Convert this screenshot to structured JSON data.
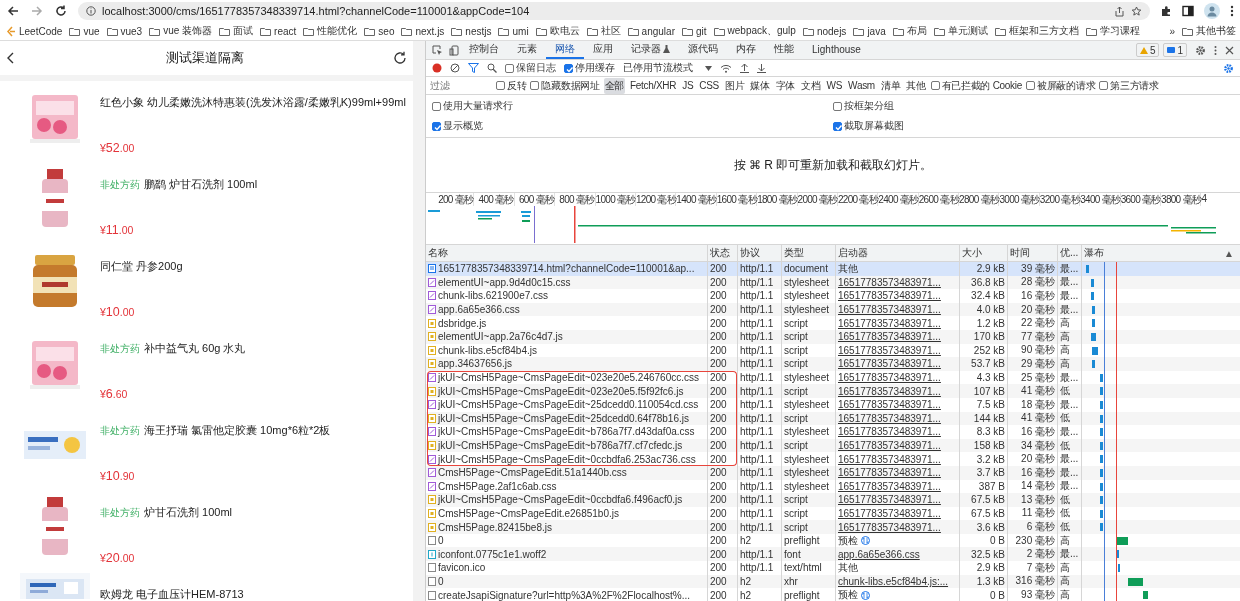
{
  "browser": {
    "nav": [
      {
        "kind": "back",
        "disabled": false
      },
      {
        "kind": "forward",
        "disabled": true
      },
      {
        "kind": "reload",
        "disabled": false
      }
    ],
    "url": "localhost:3000/cms/1651778357348339714.html?channelCode=110001&appCode=104",
    "bookmarks": [
      {
        "label": "LeetCode",
        "kind": "site"
      },
      {
        "label": "vue",
        "kind": "folder"
      },
      {
        "label": "vue3",
        "kind": "folder"
      },
      {
        "label": "vue 装饰器",
        "kind": "folder"
      },
      {
        "label": "面试",
        "kind": "folder"
      },
      {
        "label": "react",
        "kind": "folder"
      },
      {
        "label": "性能优化",
        "kind": "folder"
      },
      {
        "label": "seo",
        "kind": "folder"
      },
      {
        "label": "next.js",
        "kind": "folder"
      },
      {
        "label": "nestjs",
        "kind": "folder"
      },
      {
        "label": "umi",
        "kind": "folder"
      },
      {
        "label": "欧电云",
        "kind": "folder"
      },
      {
        "label": "社区",
        "kind": "folder"
      },
      {
        "label": "angular",
        "kind": "folder"
      },
      {
        "label": "git",
        "kind": "folder"
      },
      {
        "label": "webpack、gulp",
        "kind": "folder"
      },
      {
        "label": "nodejs",
        "kind": "folder"
      },
      {
        "label": "java",
        "kind": "folder"
      },
      {
        "label": "布局",
        "kind": "folder"
      },
      {
        "label": "单元测试",
        "kind": "folder"
      },
      {
        "label": "框架和三方文档",
        "kind": "folder"
      },
      {
        "label": "学习课程",
        "kind": "folder"
      }
    ],
    "more": "»",
    "other_bookmarks": "其他书签"
  },
  "app": {
    "title": "测试渠道隔离",
    "products": [
      {
        "name": "红色小象 幼儿柔嫩洗沐特惠装(洗发沐浴露/柔嫩乳K)99ml+99ml",
        "currency": "¥",
        "price": "52",
        "decimals": ".00",
        "kind": "box"
      },
      {
        "badge": "非处方药",
        "name": "鹏鹞 炉甘石洗剂 100ml",
        "currency": "¥",
        "price": "11",
        "decimals": ".00",
        "kind": "bottle"
      },
      {
        "name": "同仁堂 丹参200g",
        "currency": "¥",
        "price": "10",
        "decimals": ".00",
        "kind": "jar"
      },
      {
        "badge": "非处方药",
        "name": "补中益气丸 60g 水丸",
        "currency": "¥",
        "price": "6",
        "decimals": ".60",
        "kind": "box"
      },
      {
        "badge": "非处方药",
        "name": "海王抒瑞 氯雷他定胶囊 10mg*6粒*2板",
        "currency": "¥",
        "price": "10",
        "decimals": ".90",
        "kind": "flat"
      },
      {
        "badge": "非处方药",
        "name": "炉甘石洗剂 100ml",
        "currency": "¥",
        "price": "20",
        "decimals": ".00",
        "kind": "bottle"
      },
      {
        "name": "欧姆龙 电子血压计HEM-8713",
        "kind": "carton"
      }
    ]
  },
  "devtools": {
    "tabs": [
      {
        "label": "控制台",
        "selected": false,
        "kind": "plain"
      },
      {
        "label": "元素",
        "selected": false,
        "kind": "plain"
      },
      {
        "label": "网络",
        "selected": true,
        "kind": "plain"
      },
      {
        "label": "应用",
        "selected": false,
        "kind": "plain"
      },
      {
        "label": "记录器",
        "selected": false,
        "kind": "flask"
      },
      {
        "label": "源代码",
        "selected": false,
        "kind": "plain"
      },
      {
        "label": "内存",
        "selected": false,
        "kind": "plain"
      },
      {
        "label": "性能",
        "selected": false,
        "kind": "plain"
      },
      {
        "label": "Lighthouse",
        "selected": false,
        "kind": "plain"
      }
    ],
    "badges": [
      {
        "kind": "warning",
        "count": "5"
      },
      {
        "kind": "message",
        "count": "1"
      }
    ],
    "toolbar": {
      "recording": true,
      "checkboxes": [
        {
          "label": "保留日志",
          "checked": false
        },
        {
          "label": "停用缓存",
          "checked": true
        }
      ],
      "throttle": "已停用节流模式"
    },
    "filter": {
      "placeholder": "过滤",
      "checkboxes_before": [
        {
          "label": "反转",
          "checked": false
        },
        {
          "label": "隐藏数据网址",
          "checked": false
        }
      ],
      "types": [
        {
          "label": "全部",
          "selected": true
        },
        {
          "label": "Fetch/XHR",
          "selected": false
        },
        {
          "label": "JS",
          "selected": false
        },
        {
          "label": "CSS",
          "selected": false
        },
        {
          "label": "图片",
          "selected": false
        },
        {
          "label": "媒体",
          "selected": false
        },
        {
          "label": "字体",
          "selected": false
        },
        {
          "label": "文档",
          "selected": false
        },
        {
          "label": "WS",
          "selected": false
        },
        {
          "label": "Wasm",
          "selected": false
        },
        {
          "label": "清单",
          "selected": false
        },
        {
          "label": "其他",
          "selected": false
        }
      ],
      "checkboxes_after": [
        {
          "label": "有已拦截的 Cookie",
          "checked": false
        },
        {
          "label": "被屏蔽的请求",
          "checked": false
        },
        {
          "label": "第三方请求",
          "checked": false
        }
      ]
    },
    "options": [
      {
        "label": "使用大量请求行",
        "checked": false
      },
      {
        "label": "按框架分组",
        "checked": false
      },
      {
        "label": "显示概览",
        "checked": true
      },
      {
        "label": "截取屏幕截图",
        "checked": true
      }
    ],
    "hint": "按 ⌘ R 即可重新加载和截取幻灯片。",
    "overview_ticks": [
      "200 毫秒",
      "400 毫秒",
      "600 毫秒",
      "800 毫秒",
      "1000 毫秒",
      "1200 毫秒",
      "1400 毫秒",
      "1600 毫秒",
      "1800 毫秒",
      "2000 毫秒",
      "2200 毫秒",
      "2400 毫秒",
      "2600 毫秒",
      "2800 毫秒",
      "3000 毫秒",
      "3200 毫秒",
      "3400 毫秒",
      "3600 毫秒",
      "3800 毫秒",
      "4"
    ],
    "table": {
      "columns": [
        "名称",
        "状态",
        "协议",
        "类型",
        "启动器",
        "大小",
        "时间",
        "优...",
        "瀑布"
      ],
      "sort_indicator": "▲",
      "rows": [
        {
          "name": "1651778357348339714.html?channelCode=110001&ap...",
          "status": "200",
          "protocol": "http/1.1",
          "type": "document",
          "initiator": {
            "text": "其他",
            "kind": "plain"
          },
          "size": "2.9 kB",
          "time": "39 毫秒",
          "priority": "最...",
          "kind": "document",
          "selected": true,
          "highlighted": false
        },
        {
          "name": "elementUI~app.9d4d0c15.css",
          "status": "200",
          "protocol": "http/1.1",
          "type": "stylesheet",
          "initiator": {
            "text": "16517783573483971...",
            "kind": "link"
          },
          "size": "36.8 kB",
          "time": "28 毫秒",
          "priority": "最...",
          "kind": "stylesheet",
          "selected": false,
          "highlighted": false
        },
        {
          "name": "chunk-libs.621900e7.css",
          "status": "200",
          "protocol": "http/1.1",
          "type": "stylesheet",
          "initiator": {
            "text": "16517783573483971...",
            "kind": "link"
          },
          "size": "32.4 kB",
          "time": "16 毫秒",
          "priority": "最...",
          "kind": "stylesheet",
          "selected": false,
          "highlighted": false
        },
        {
          "name": "app.6a65e366.css",
          "status": "200",
          "protocol": "http/1.1",
          "type": "stylesheet",
          "initiator": {
            "text": "16517783573483971...",
            "kind": "link"
          },
          "size": "4.0 kB",
          "time": "20 毫秒",
          "priority": "最...",
          "kind": "stylesheet",
          "selected": false,
          "highlighted": false
        },
        {
          "name": "dsbridge.js",
          "status": "200",
          "protocol": "http/1.1",
          "type": "script",
          "initiator": {
            "text": "16517783573483971...",
            "kind": "link"
          },
          "size": "1.2 kB",
          "time": "22 毫秒",
          "priority": "高",
          "kind": "script",
          "selected": false,
          "highlighted": false
        },
        {
          "name": "elementUI~app.2a76c4d7.js",
          "status": "200",
          "protocol": "http/1.1",
          "type": "script",
          "initiator": {
            "text": "16517783573483971...",
            "kind": "link"
          },
          "size": "170 kB",
          "time": "77 毫秒",
          "priority": "高",
          "kind": "script",
          "selected": false,
          "highlighted": false
        },
        {
          "name": "chunk-libs.e5cf84b4.js",
          "status": "200",
          "protocol": "http/1.1",
          "type": "script",
          "initiator": {
            "text": "16517783573483971...",
            "kind": "link"
          },
          "size": "252 kB",
          "time": "90 毫秒",
          "priority": "高",
          "kind": "script",
          "selected": false,
          "highlighted": false
        },
        {
          "name": "app.34637656.js",
          "status": "200",
          "protocol": "http/1.1",
          "type": "script",
          "initiator": {
            "text": "16517783573483971...",
            "kind": "link"
          },
          "size": "53.7 kB",
          "time": "29 毫秒",
          "priority": "高",
          "kind": "script",
          "selected": false,
          "highlighted": false
        },
        {
          "name": "jkUI~CmsH5Page~CmsPageEdit~023e20e5.246760cc.css",
          "status": "200",
          "protocol": "http/1.1",
          "type": "stylesheet",
          "initiator": {
            "text": "16517783573483971...",
            "kind": "link"
          },
          "size": "4.3 kB",
          "time": "25 毫秒",
          "priority": "最...",
          "kind": "stylesheet",
          "selected": false,
          "highlighted": true
        },
        {
          "name": "jkUI~CmsH5Page~CmsPageEdit~023e20e5.f5f92fc6.js",
          "status": "200",
          "protocol": "http/1.1",
          "type": "script",
          "initiator": {
            "text": "16517783573483971...",
            "kind": "link"
          },
          "size": "107 kB",
          "time": "41 毫秒",
          "priority": "低",
          "kind": "script",
          "selected": false,
          "highlighted": true
        },
        {
          "name": "jkUI~CmsH5Page~CmsPageEdit~25dcedd0.110054cd.css",
          "status": "200",
          "protocol": "http/1.1",
          "type": "stylesheet",
          "initiator": {
            "text": "16517783573483971...",
            "kind": "link"
          },
          "size": "7.5 kB",
          "time": "18 毫秒",
          "priority": "最...",
          "kind": "stylesheet",
          "selected": false,
          "highlighted": true
        },
        {
          "name": "jkUI~CmsH5Page~CmsPageEdit~25dcedd0.64f78b16.js",
          "status": "200",
          "protocol": "http/1.1",
          "type": "script",
          "initiator": {
            "text": "16517783573483971...",
            "kind": "link"
          },
          "size": "144 kB",
          "time": "41 毫秒",
          "priority": "低",
          "kind": "script",
          "selected": false,
          "highlighted": true
        },
        {
          "name": "jkUI~CmsH5Page~CmsPageEdit~b786a7f7.d43daf0a.css",
          "status": "200",
          "protocol": "http/1.1",
          "type": "stylesheet",
          "initiator": {
            "text": "16517783573483971...",
            "kind": "link"
          },
          "size": "8.3 kB",
          "time": "16 毫秒",
          "priority": "最...",
          "kind": "stylesheet",
          "selected": false,
          "highlighted": true
        },
        {
          "name": "jkUI~CmsH5Page~CmsPageEdit~b786a7f7.cf7cfedc.js",
          "status": "200",
          "protocol": "http/1.1",
          "type": "script",
          "initiator": {
            "text": "16517783573483971...",
            "kind": "link"
          },
          "size": "158 kB",
          "time": "34 毫秒",
          "priority": "低",
          "kind": "script",
          "selected": false,
          "highlighted": true
        },
        {
          "name": "jkUI~CmsH5Page~CmsPageEdit~0ccbdfa6.253ac736.css",
          "status": "200",
          "protocol": "http/1.1",
          "type": "stylesheet",
          "initiator": {
            "text": "16517783573483971...",
            "kind": "link"
          },
          "size": "3.2 kB",
          "time": "20 毫秒",
          "priority": "最...",
          "kind": "stylesheet",
          "selected": false,
          "highlighted": true
        },
        {
          "name": "CmsH5Page~CmsPageEdit.51a1440b.css",
          "status": "200",
          "protocol": "http/1.1",
          "type": "stylesheet",
          "initiator": {
            "text": "16517783573483971...",
            "kind": "link"
          },
          "size": "3.7 kB",
          "time": "16 毫秒",
          "priority": "最...",
          "kind": "stylesheet",
          "selected": false,
          "highlighted": false
        },
        {
          "name": "CmsH5Page.2af1c6ab.css",
          "status": "200",
          "protocol": "http/1.1",
          "type": "stylesheet",
          "initiator": {
            "text": "16517783573483971...",
            "kind": "link"
          },
          "size": "387 B",
          "time": "14 毫秒",
          "priority": "最...",
          "kind": "stylesheet",
          "selected": false,
          "highlighted": false
        },
        {
          "name": "jkUI~CmsH5Page~CmsPageEdit~0ccbdfa6.f496acf0.js",
          "status": "200",
          "protocol": "http/1.1",
          "type": "script",
          "initiator": {
            "text": "16517783573483971...",
            "kind": "link"
          },
          "size": "67.5 kB",
          "time": "13 毫秒",
          "priority": "低",
          "kind": "script",
          "selected": false,
          "highlighted": false
        },
        {
          "name": "CmsH5Page~CmsPageEdit.e26851b0.js",
          "status": "200",
          "protocol": "http/1.1",
          "type": "script",
          "initiator": {
            "text": "16517783573483971...",
            "kind": "link"
          },
          "size": "67.5 kB",
          "time": "11 毫秒",
          "priority": "低",
          "kind": "script",
          "selected": false,
          "highlighted": false
        },
        {
          "name": "CmsH5Page.82415be8.js",
          "status": "200",
          "protocol": "http/1.1",
          "type": "script",
          "initiator": {
            "text": "16517783573483971...",
            "kind": "link"
          },
          "size": "3.6 kB",
          "time": "6 毫秒",
          "priority": "低",
          "kind": "script",
          "selected": false,
          "highlighted": false
        },
        {
          "name": "0",
          "status": "200",
          "protocol": "h2",
          "type": "preflight",
          "initiator": {
            "text": "预检",
            "kind": "preflight"
          },
          "size": "0 B",
          "time": "230 毫秒",
          "priority": "高",
          "kind": "other",
          "selected": false,
          "highlighted": false
        },
        {
          "name": "iconfont.0775c1e1.woff2",
          "status": "200",
          "protocol": "http/1.1",
          "type": "font",
          "initiator": {
            "text": "app.6a65e366.css",
            "kind": "link"
          },
          "size": "32.5 kB",
          "time": "2 毫秒",
          "priority": "最...",
          "kind": "font",
          "selected": false,
          "highlighted": false
        },
        {
          "name": "favicon.ico",
          "status": "200",
          "protocol": "http/1.1",
          "type": "text/html",
          "initiator": {
            "text": "其他",
            "kind": "plain"
          },
          "size": "2.9 kB",
          "time": "7 毫秒",
          "priority": "高",
          "kind": "other",
          "selected": false,
          "highlighted": false
        },
        {
          "name": "0",
          "status": "200",
          "protocol": "h2",
          "type": "xhr",
          "initiator": {
            "text": "chunk-libs.e5cf84b4.js:...",
            "kind": "link"
          },
          "size": "1.3 kB",
          "time": "316 毫秒",
          "priority": "高",
          "kind": "other",
          "selected": false,
          "highlighted": false
        },
        {
          "name": "createJsapiSignature?url=http%3A%2F%2Flocalhost%...",
          "status": "200",
          "protocol": "h2",
          "type": "preflight",
          "initiator": {
            "text": "预检",
            "kind": "preflight"
          },
          "size": "0 B",
          "time": "93 毫秒",
          "priority": "高",
          "kind": "other",
          "selected": false,
          "highlighted": false
        }
      ]
    }
  }
}
